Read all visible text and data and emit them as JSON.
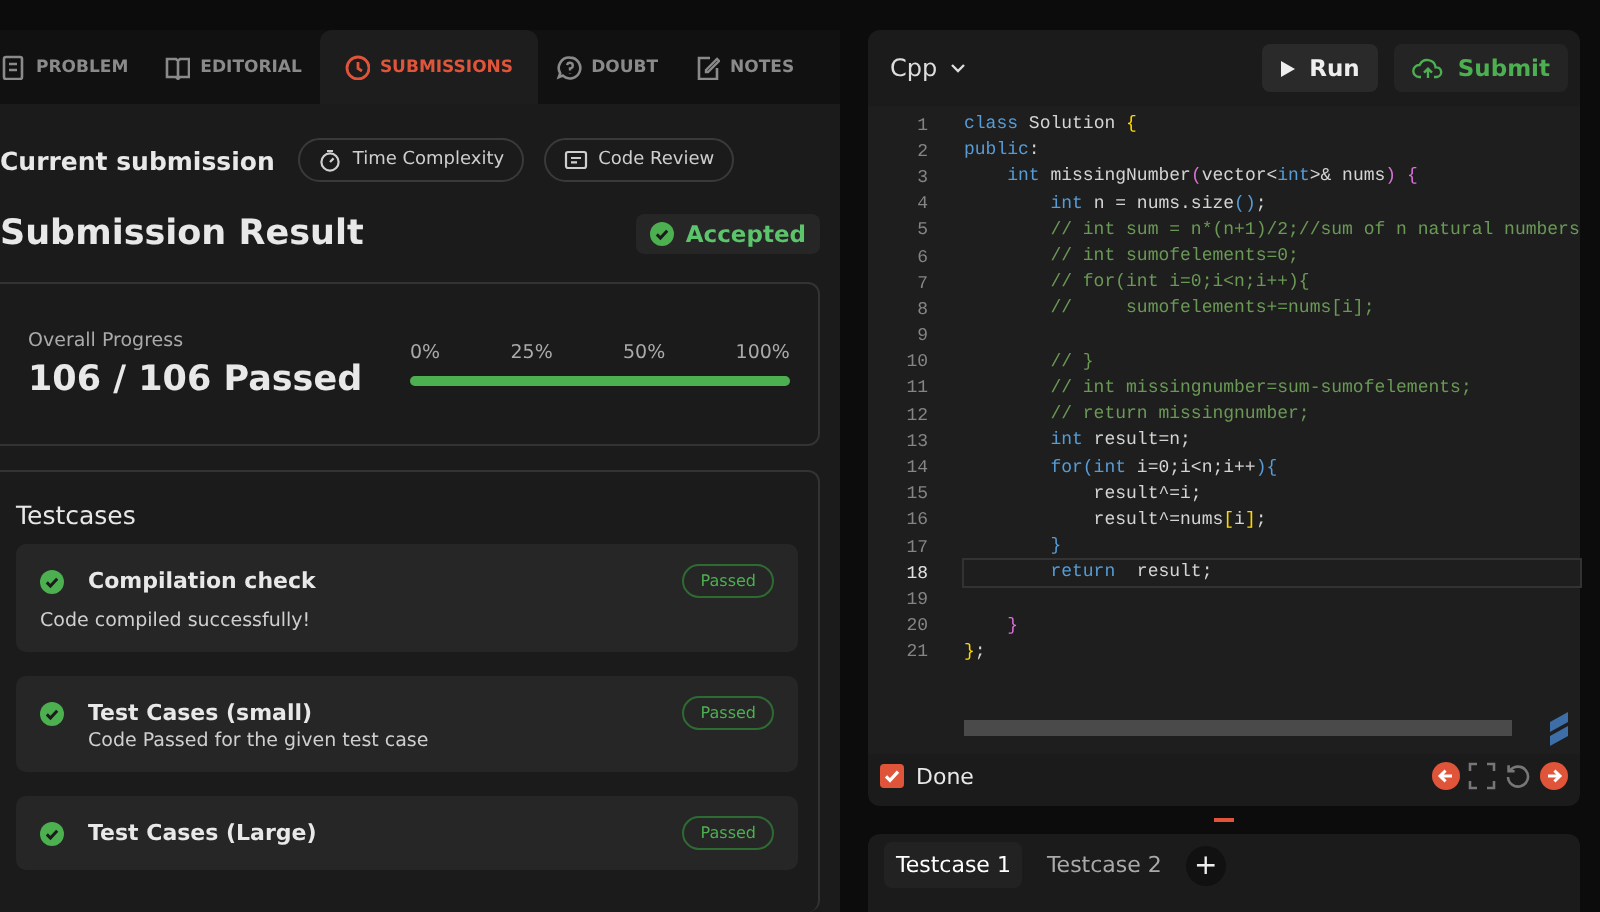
{
  "tabs": [
    {
      "label": "PROBLEM",
      "selected": false
    },
    {
      "label": "EDITORIAL",
      "selected": false
    },
    {
      "label": "SUBMISSIONS",
      "selected": true
    },
    {
      "label": "DOUBT",
      "selected": false
    },
    {
      "label": "NOTES",
      "selected": false
    }
  ],
  "submission": {
    "heading": "Current submission",
    "chips": [
      {
        "label": "Time Complexity"
      },
      {
        "label": "Code Review"
      }
    ],
    "result_title": "Submission Result",
    "verdict": "Accepted"
  },
  "progress": {
    "label": "Overall Progress",
    "summary": "106 / 106 Passed",
    "ticks": [
      "0%",
      "25%",
      "50%",
      "100%"
    ],
    "level": 1.0
  },
  "testcases": {
    "title": "Testcases",
    "items": [
      {
        "name": "Compilation check",
        "description": "Code compiled successfully!",
        "status": "Passed"
      },
      {
        "name": "Test Cases (small)",
        "description": "Code Passed for the given test case",
        "status": "Passed"
      },
      {
        "name": "Test Cases (Large)",
        "status": "Passed"
      }
    ]
  },
  "editor": {
    "language": "Cpp",
    "run_label": "Run",
    "submit_label": "Submit",
    "lines": [
      {
        "number": "1",
        "active": false,
        "tokens": [
          {
            "text": "class",
            "kind": "kw"
          },
          {
            "text": " Solution ",
            "kind": "id"
          },
          {
            "text": "{",
            "kind": "br"
          }
        ]
      },
      {
        "number": "2",
        "active": false,
        "tokens": [
          {
            "text": "public",
            "kind": "kw"
          },
          {
            "text": ":",
            "kind": "id"
          }
        ]
      },
      {
        "number": "3",
        "active": false,
        "tokens": [
          {
            "text": "    int",
            "kind": "kw"
          },
          {
            "text": " missingNumber",
            "kind": "id"
          },
          {
            "text": "(",
            "kind": "pu"
          },
          {
            "text": "vector<",
            "kind": "id"
          },
          {
            "text": "int",
            "kind": "kw"
          },
          {
            "text": ">& nums",
            "kind": "id"
          },
          {
            "text": ") {",
            "kind": "pu"
          }
        ]
      },
      {
        "number": "4",
        "active": false,
        "tokens": [
          {
            "text": "        int",
            "kind": "kw"
          },
          {
            "text": " n = nums.size",
            "kind": "id"
          },
          {
            "text": "()",
            "kind": "kw"
          },
          {
            "text": ";",
            "kind": "id"
          }
        ]
      },
      {
        "number": "5",
        "active": false,
        "tokens": [
          {
            "text": "        // int sum = n*(n+1)/2;//sum of n natural numbers",
            "kind": "cm"
          }
        ]
      },
      {
        "number": "6",
        "active": false,
        "tokens": [
          {
            "text": "        // int sumofelements=0;",
            "kind": "cm"
          }
        ]
      },
      {
        "number": "7",
        "active": false,
        "tokens": [
          {
            "text": "        // for(int i=0;i<n;i++){",
            "kind": "cm"
          }
        ]
      },
      {
        "number": "8",
        "active": false,
        "tokens": [
          {
            "text": "        //     sumofelements+=nums[i];",
            "kind": "cm"
          }
        ]
      },
      {
        "number": "9",
        "active": false
      },
      {
        "number": "10",
        "active": false,
        "tokens": [
          {
            "text": "        // }",
            "kind": "cm"
          }
        ]
      },
      {
        "number": "11",
        "active": false,
        "tokens": [
          {
            "text": "        // int missingnumber=sum-sumofelements;",
            "kind": "cm"
          }
        ]
      },
      {
        "number": "12",
        "active": false,
        "tokens": [
          {
            "text": "        // return missingnumber;",
            "kind": "cm"
          }
        ]
      },
      {
        "number": "13",
        "active": false,
        "tokens": [
          {
            "text": "        int",
            "kind": "kw"
          },
          {
            "text": " result=n;",
            "kind": "id"
          }
        ]
      },
      {
        "number": "14",
        "active": false,
        "tokens": [
          {
            "text": "        for(int",
            "kind": "kw"
          },
          {
            "text": " i=0;i<n;i++",
            "kind": "id"
          },
          {
            "text": "){",
            "kind": "kw"
          }
        ]
      },
      {
        "number": "15",
        "active": false,
        "tokens": [
          {
            "text": "            result^=i;",
            "kind": "id"
          }
        ]
      },
      {
        "number": "16",
        "active": false,
        "tokens": [
          {
            "text": "            result^=nums",
            "kind": "id"
          },
          {
            "text": "[",
            "kind": "br"
          },
          {
            "text": "i",
            "kind": "id"
          },
          {
            "text": "]",
            "kind": "br"
          },
          {
            "text": ";",
            "kind": "id"
          }
        ]
      },
      {
        "number": "17",
        "active": false,
        "tokens": [
          {
            "text": "        }",
            "kind": "kw"
          }
        ]
      },
      {
        "number": "18",
        "active": true,
        "tokens": [
          {
            "text": "        return",
            "kind": "kw"
          },
          {
            "text": "  result;",
            "kind": "id"
          }
        ]
      },
      {
        "number": "19",
        "active": false
      },
      {
        "number": "20",
        "active": false,
        "tokens": [
          {
            "text": "    }",
            "kind": "pu"
          }
        ]
      },
      {
        "number": "21",
        "active": false,
        "tokens": [
          {
            "text": "}",
            "kind": "br"
          },
          {
            "text": ";",
            "kind": "id"
          }
        ]
      }
    ],
    "done": {
      "label": "Done",
      "checked": true
    }
  },
  "testcase_tabs": [
    {
      "label": "Testcase 1",
      "selected": true
    },
    {
      "label": "Testcase 2",
      "selected": false
    }
  ],
  "add_tab": "+"
}
